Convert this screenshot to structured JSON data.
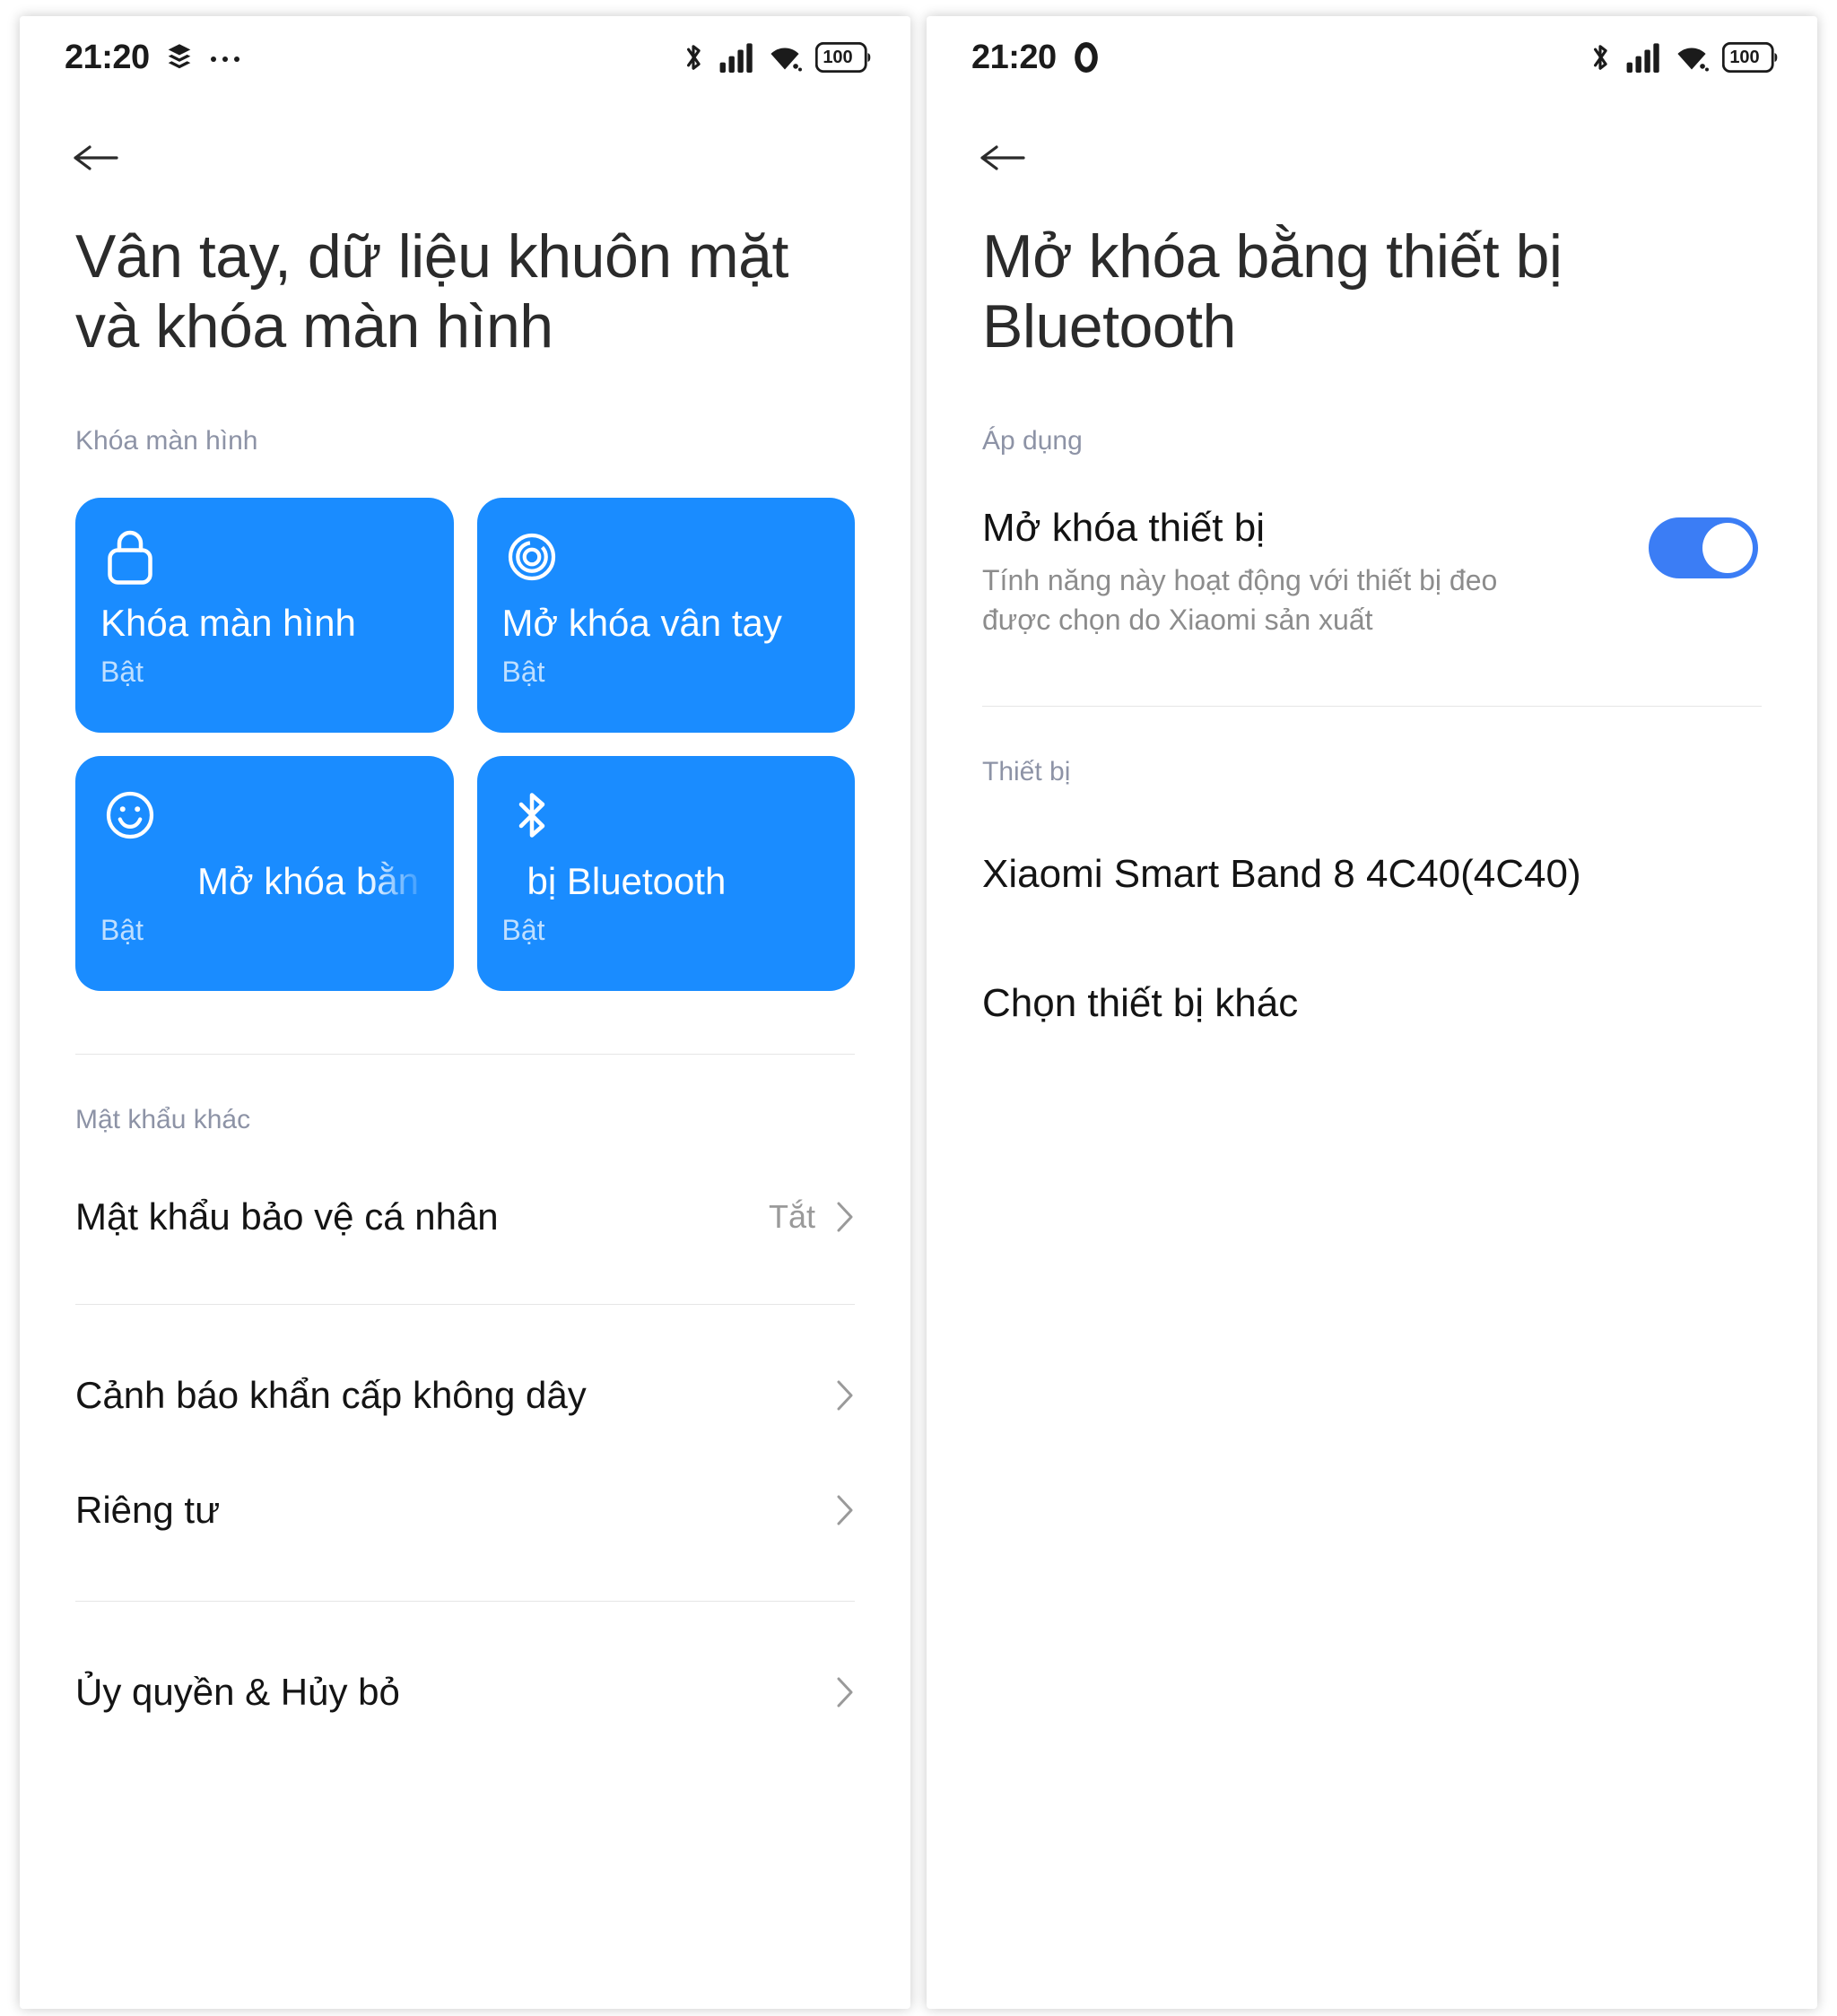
{
  "left": {
    "status_bar": {
      "time": "21:20",
      "left_icons": [
        "layers-icon",
        "more-dots-icon"
      ],
      "right_icons": [
        "bluetooth-icon",
        "signal-icon",
        "wifi-icon",
        "battery-icon"
      ],
      "battery_level": "100"
    },
    "back_icon": "back-arrow-icon",
    "title": "Vân tay, dữ liệu khuôn mặt và khóa màn hình",
    "section_lockscreen": "Khóa màn hình",
    "tiles": [
      {
        "icon": "lock-icon",
        "title": "Khóa màn hình",
        "subtitle": "Bật"
      },
      {
        "icon": "fingerprint-icon",
        "title": "Mở khóa vân tay",
        "subtitle": "Bật"
      },
      {
        "icon": "face-smile-icon",
        "title": "Mở khóa bằn",
        "subtitle": "Bật"
      },
      {
        "icon": "bluetooth-icon",
        "title": "bị Bluetooth",
        "subtitle": "Bật"
      }
    ],
    "section_otherpw": "Mật khẩu khác",
    "rows": [
      {
        "label": "Mật khẩu bảo vệ cá nhân",
        "value": "Tắt",
        "chevron": "chevron-right-icon"
      },
      {
        "label": "Cảnh báo khẩn cấp không dây",
        "value": "",
        "chevron": "chevron-right-icon"
      },
      {
        "label": "Riêng tư",
        "value": "",
        "chevron": "chevron-right-icon"
      },
      {
        "label": "Ủy quyền & Hủy bỏ",
        "value": "",
        "chevron": "chevron-right-icon"
      }
    ]
  },
  "right": {
    "status_bar": {
      "time": "21:20",
      "left_icons": [
        "circle-icon"
      ],
      "right_icons": [
        "bluetooth-icon",
        "signal-icon",
        "wifi-icon",
        "battery-icon"
      ],
      "battery_level": "100"
    },
    "back_icon": "back-arrow-icon",
    "title": "Mở khóa bằng thiết bị Bluetooth",
    "section_apply": "Áp dụng",
    "toggle_item": {
      "title": "Mở khóa thiết bị",
      "description": "Tính năng này hoạt động với thiết bị đeo được chọn do Xiaomi sản xuất",
      "state": "on"
    },
    "section_devices": "Thiết bị",
    "devices": [
      {
        "label": "Xiaomi Smart Band 8 4C40(4C40)"
      },
      {
        "label": "Chọn thiết bị khác"
      }
    ]
  },
  "colors": {
    "tile_blue": "#1a8cff",
    "toggle_blue": "#3b7df5",
    "section_header": "#8d93a6",
    "muted_text": "#8c8c8c"
  }
}
